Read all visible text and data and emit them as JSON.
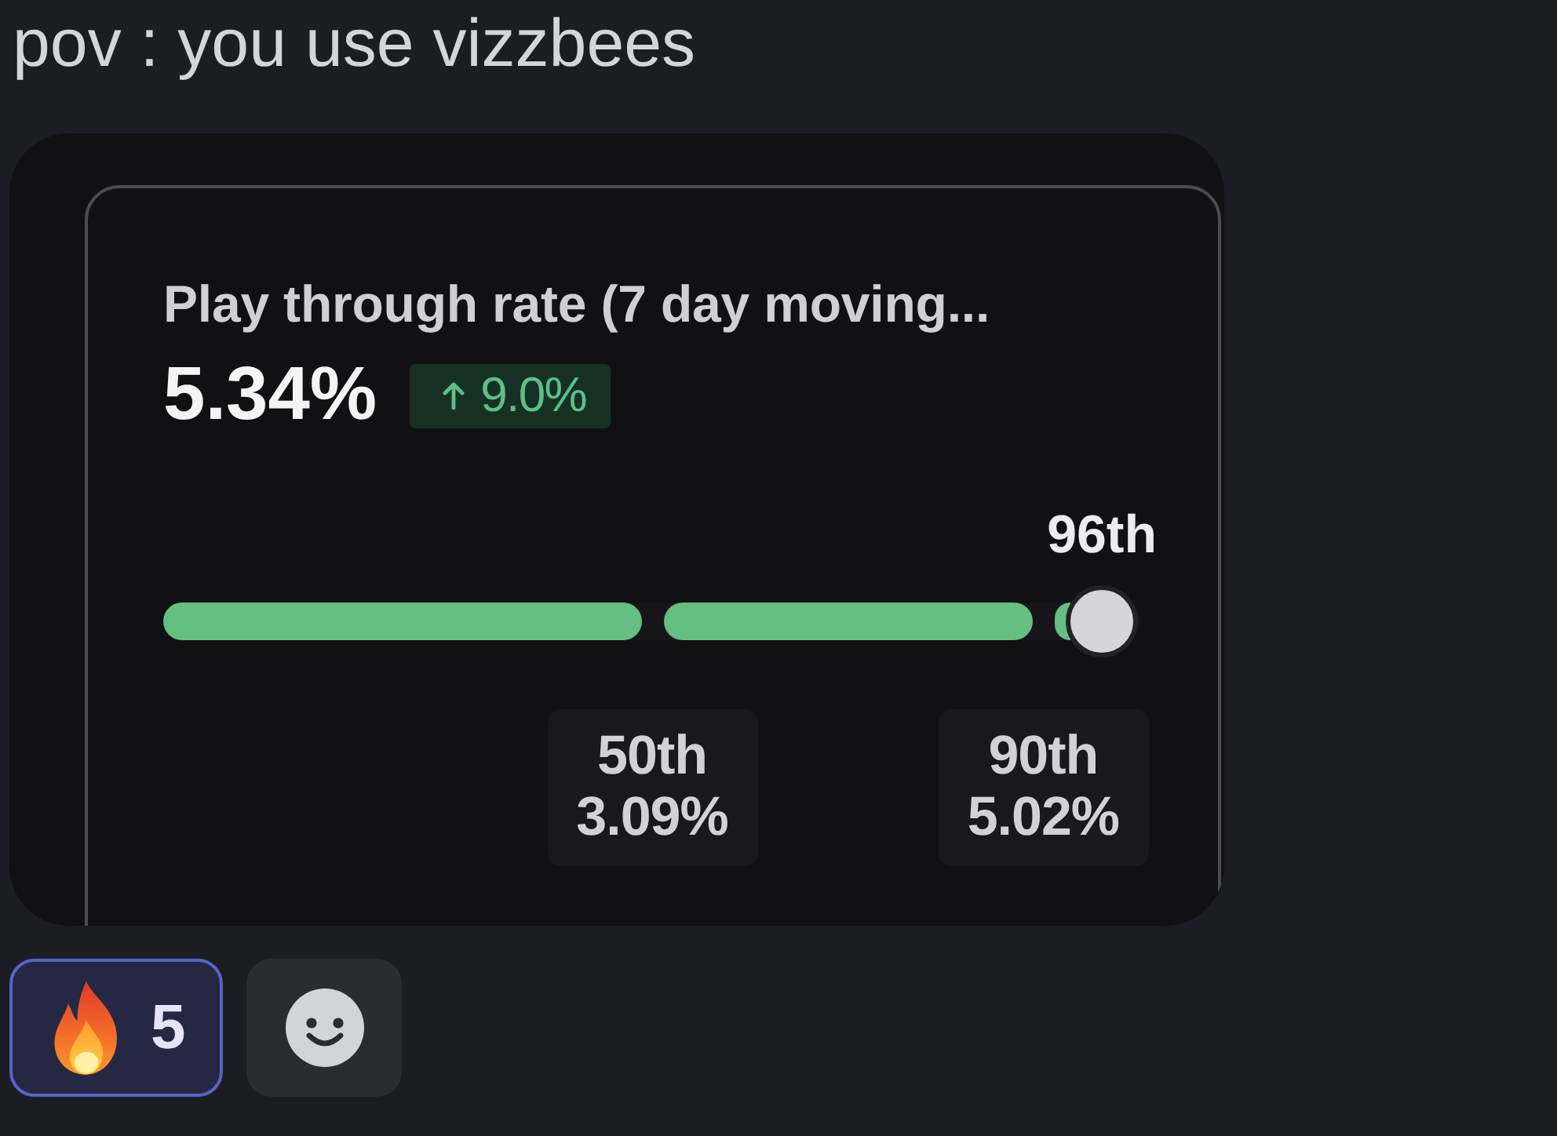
{
  "message": {
    "text": "pov : you use vizzbees"
  },
  "attachment": {
    "card": {
      "title": "Play through rate (7 day moving...",
      "value": "5.34%",
      "change": {
        "increase": true,
        "text": "9.0%"
      },
      "percentile": {
        "label": "96th",
        "level": 0.96,
        "benchmarks": [
          {
            "label": "50th",
            "value": "3.09%",
            "level": 0.5
          },
          {
            "label": "90th",
            "value": "5.02%",
            "level": 0.9
          }
        ]
      }
    }
  },
  "reactions": [
    {
      "count": "5",
      "selected": true
    }
  ]
}
